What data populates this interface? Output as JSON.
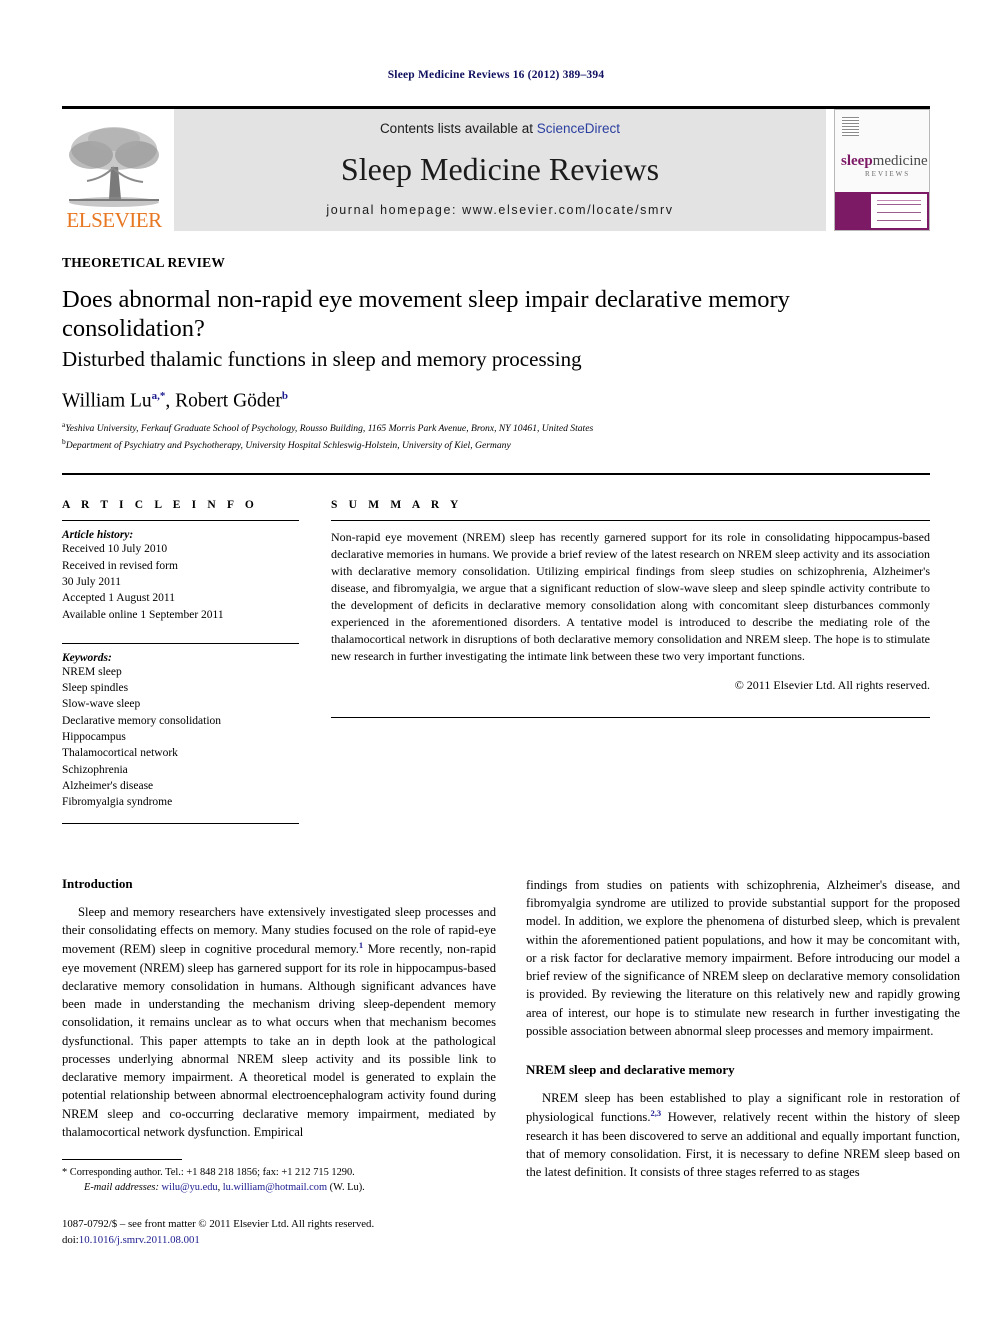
{
  "running_head": "Sleep Medicine Reviews 16 (2012) 389–394",
  "masthead": {
    "publisher_name": "ELSEVIER",
    "contents_prefix": "Contents lists available at ",
    "contents_link": "ScienceDirect",
    "journal_title": "Sleep Medicine Reviews",
    "homepage": "journal homepage: www.elsevier.com/locate/smrv",
    "cover": {
      "title_part1": "sleep",
      "title_part2": "medicine",
      "subtitle": "REVIEWS"
    }
  },
  "article": {
    "kicker": "THEORETICAL REVIEW",
    "title": "Does abnormal non-rapid eye movement sleep impair declarative memory consolidation?",
    "subtitle": "Disturbed thalamic functions in sleep and memory processing",
    "authors": [
      {
        "name": "William Lu",
        "marks": "a,*"
      },
      {
        "name": "Robert Göder",
        "marks": "b"
      }
    ],
    "affiliations": [
      {
        "mark": "a",
        "text": "Yeshiva University, Ferkauf Graduate School of Psychology, Rousso Building, 1165 Morris Park Avenue, Bronx, NY 10461, United States"
      },
      {
        "mark": "b",
        "text": "Department of Psychiatry and Psychotherapy, University Hospital Schleswig-Holstein, University of Kiel, Germany"
      }
    ]
  },
  "article_info": {
    "heading": "A R T I C L E   I N F O",
    "history_label": "Article history:",
    "history": [
      "Received 10 July 2010",
      "Received in revised form",
      "30 July 2011",
      "Accepted 1 August 2011",
      "Available online 1 September 2011"
    ],
    "keywords_label": "Keywords:",
    "keywords": [
      "NREM sleep",
      "Sleep spindles",
      "Slow-wave sleep",
      "Declarative memory consolidation",
      "Hippocampus",
      "Thalamocortical network",
      "Schizophrenia",
      "Alzheimer's disease",
      "Fibromyalgia syndrome"
    ]
  },
  "summary": {
    "heading": "S U M M A R Y",
    "text": "Non-rapid eye movement (NREM) sleep has recently garnered support for its role in consolidating hippocampus-based declarative memories in humans. We provide a brief review of the latest research on NREM sleep activity and its association with declarative memory consolidation. Utilizing empirical findings from sleep studies on schizophrenia, Alzheimer's disease, and fibromyalgia, we argue that a significant reduction of slow-wave sleep and sleep spindle activity contribute to the development of deficits in declarative memory consolidation along with concomitant sleep disturbances commonly experienced in the aforementioned disorders. A tentative model is introduced to describe the mediating role of the thalamocortical network in disruptions of both declarative memory consolidation and NREM sleep. The hope is to stimulate new research in further investigating the intimate link between these two very important functions.",
    "copyright": "© 2011 Elsevier Ltd. All rights reserved."
  },
  "body": {
    "left": {
      "heading": "Introduction",
      "paragraph_part1": "Sleep and memory researchers have extensively investigated sleep processes and their consolidating effects on memory. Many studies focused on the role of rapid-eye movement (REM) sleep in cognitive procedural memory.",
      "ref1": "1",
      "paragraph_part2": " More recently, non-rapid eye movement (NREM) sleep has garnered support for its role in hippocampus-based declarative memory consolidation in humans. Although significant advances have been made in understanding the mechanism driving sleep-dependent memory consolidation, it remains unclear as to what occurs when that mechanism becomes dysfunctional. This paper attempts to take an in depth look at the pathological processes underlying abnormal NREM sleep activity and its possible link to declarative memory impairment. A theoretical model is generated to explain the potential relationship between abnormal electroencephalogram activity found during NREM sleep and co-occurring declarative memory impairment, mediated by thalamocortical network dysfunction. Empirical"
    },
    "right": {
      "paragraph_continued": "findings from studies on patients with schizophrenia, Alzheimer's disease, and fibromyalgia syndrome are utilized to provide substantial support for the proposed model. In addition, we explore the phenomena of disturbed sleep, which is prevalent within the aforementioned patient populations, and how it may be concomitant with, or a risk factor for declarative memory impairment. Before introducing our model a brief review of the significance of NREM sleep on declarative memory consolidation is provided. By reviewing the literature on this relatively new and rapidly growing area of interest, our hope is to stimulate new research in further investigating the possible association between abnormal sleep processes and memory impairment.",
      "heading2": "NREM sleep and declarative memory",
      "paragraph2_part1": "NREM sleep has been established to play a significant role in restoration of physiological functions.",
      "ref23": "2,3",
      "paragraph2_part2": " However, relatively recent within the history of sleep research it has been discovered to serve an additional and equally important function, that of memory consolidation. First, it is necessary to define NREM sleep based on the latest definition. It consists of three stages referred to as stages"
    }
  },
  "footnote": {
    "corresponding": "* Corresponding author. Tel.: +1 848 218 1856; fax: +1 212 715 1290.",
    "email_label": "E-mail addresses:",
    "email1": "wilu@yu.edu",
    "email2": "lu.william@hotmail.com",
    "email_suffix": "(W. Lu)."
  },
  "issn": {
    "line1": "1087-0792/$ – see front matter © 2011 Elsevier Ltd. All rights reserved.",
    "doi_prefix": "doi:",
    "doi": "10.1016/j.smrv.2011.08.001"
  },
  "colors": {
    "link": "#1b1b8f",
    "elsevier_orange": "#E87722",
    "science_direct": "#2b3fa0",
    "cover_purple": "#7d1a66",
    "banner_gray": "#e3e3e3"
  }
}
